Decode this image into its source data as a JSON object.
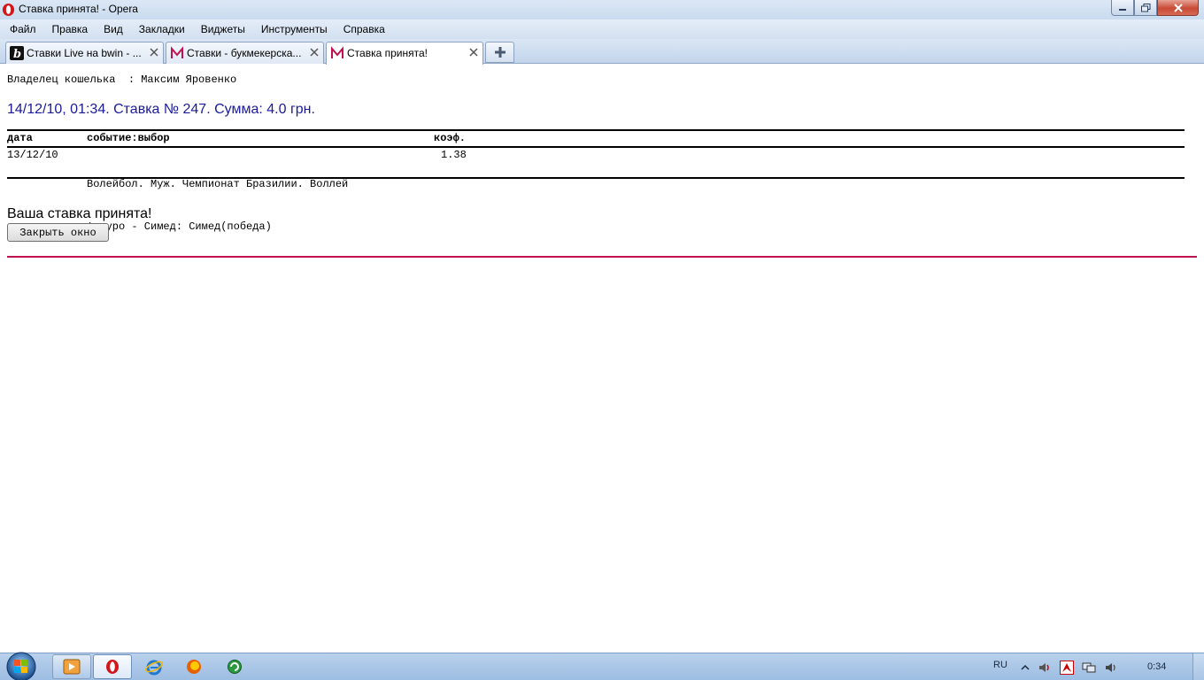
{
  "window": {
    "title": "Ставка принята! - Opera",
    "logo_icon": "opera-logo-icon",
    "controls": [
      "minimize-icon",
      "maximize-icon",
      "close-icon"
    ]
  },
  "menu": {
    "items": [
      "Файл",
      "Правка",
      "Вид",
      "Закладки",
      "Виджеты",
      "Инструменты",
      "Справка"
    ]
  },
  "tabs": [
    {
      "label": "Ставки Live на bwin - ...",
      "icon": "bwin-logo-icon"
    },
    {
      "label": "Ставки - букмекерска...",
      "icon": "marathon-logo-icon"
    },
    {
      "label": "Ставка принята!",
      "icon": "marathon-logo-icon",
      "active": true
    }
  ],
  "page": {
    "owner": "Владелец кошелька  : Максим Яровенко",
    "bet_line": "14/12/10, 01:34. Ставка № 247. Сумма: 4.0 грн.",
    "table": {
      "headers": {
        "date": "дата",
        "event": "событие:выбор",
        "odds": "коэф."
      },
      "rows": [
        {
          "date": "13/12/10",
          "event_line1": "Волейбол. Муж. Чемпионат Бразилии. Воллей",
          "event_line2": "Футуро - Симед: Симед(победа)",
          "odds": "1.38"
        }
      ]
    },
    "accepted_message": "Ваша ставка принята!",
    "close_button": "Закрыть окно",
    "accent_color": "#c0124f",
    "bet_line_color": "#1a1a9a"
  },
  "taskbar": {
    "items": [
      "windows-start-icon",
      "media-player-icon",
      "opera-icon",
      "internet-explorer-icon",
      "firefox-icon",
      "green-app-icon"
    ],
    "language": "RU",
    "tray_icons": [
      "show-hidden-icons-icon",
      "volume-icon",
      "antivirus-icon",
      "network-icon",
      "speaker-icon"
    ],
    "clock": "0:34"
  }
}
